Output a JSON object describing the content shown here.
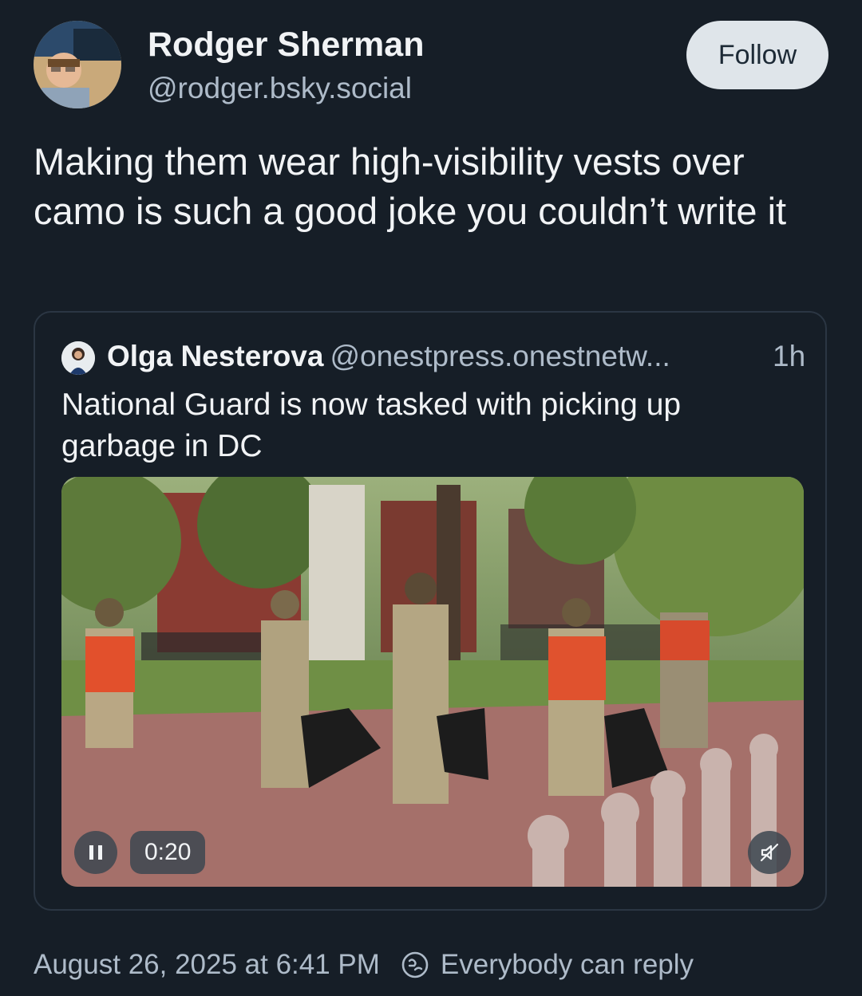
{
  "post": {
    "author_name": "Rodger Sherman",
    "author_handle": "@rodger.bsky.social",
    "follow_label": "Follow",
    "text": "Making them wear high-visibility vests over camo is such a good joke you couldn’t write it",
    "timestamp": "August 26, 2025 at 6:41 PM",
    "reply_setting": "Everybody can reply"
  },
  "quote": {
    "author_name": "Olga Nesterova",
    "author_handle": "@onestpress.onestnetw...",
    "time": "1h",
    "text": "National Guard is now tasked with picking up garbage in DC",
    "video": {
      "duration": "0:20",
      "state": "playing",
      "muted": true
    }
  },
  "icons": {
    "play_pause": "pause-icon",
    "mute": "muted-speaker-icon",
    "reply": "reply-settings-icon"
  },
  "colors": {
    "background": "#161e27",
    "follow_button": "#dfe5ea",
    "muted_text": "#aebbc9"
  }
}
